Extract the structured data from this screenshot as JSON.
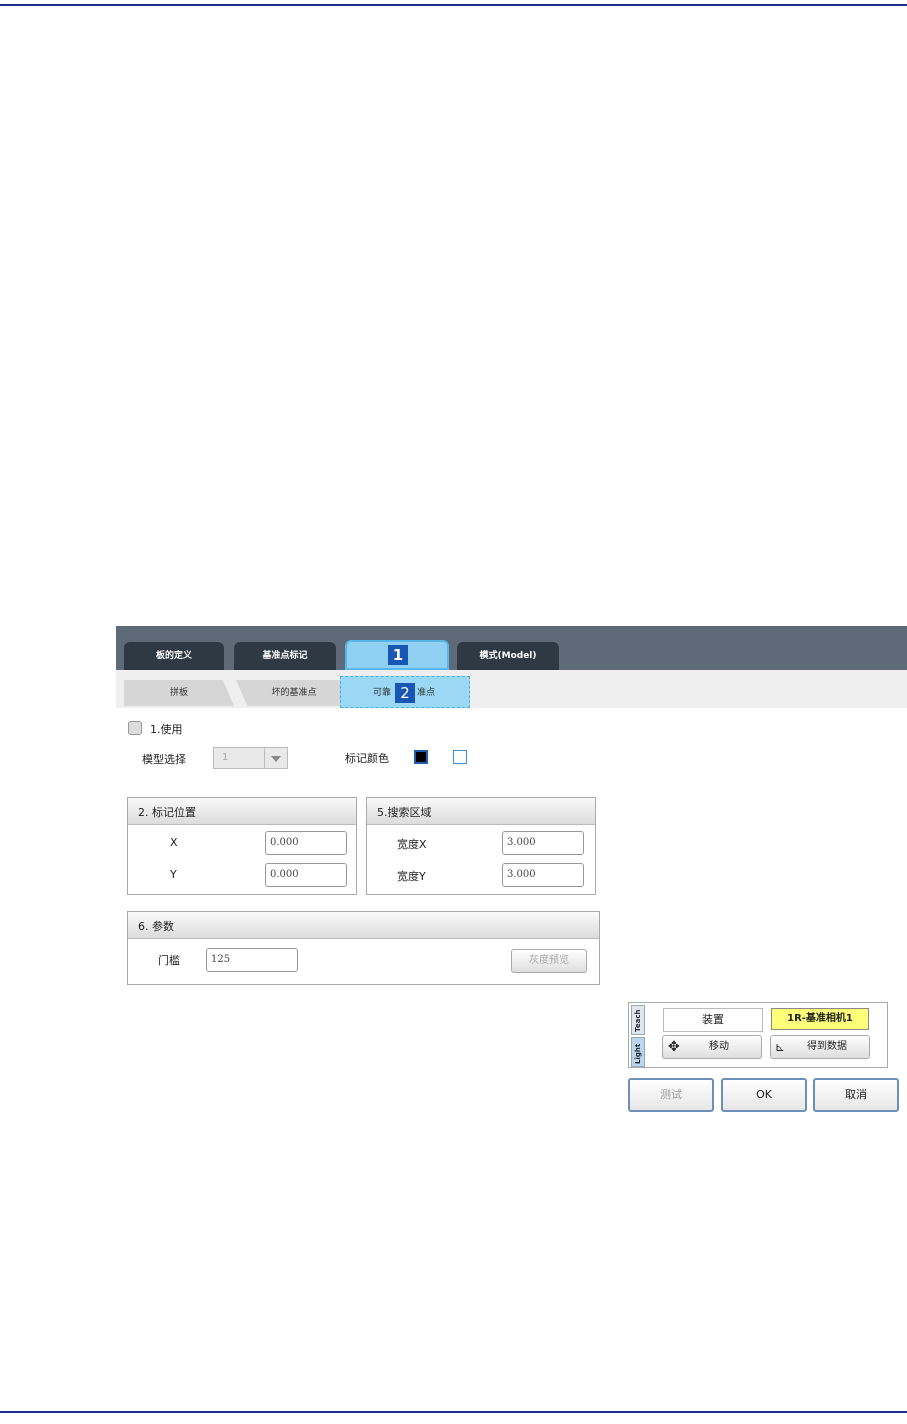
{
  "tabs": [
    "板的定义",
    "基准点标记",
    "",
    "模式(Model)"
  ],
  "callouts": [
    "1",
    "2"
  ],
  "subtabs": [
    "拼板",
    "坏的基准点",
    "可靠",
    "准点"
  ],
  "use_checkbox_label": "1.使用",
  "model_select": {
    "label": "模型选择",
    "value": "1"
  },
  "mark_color": {
    "label": "标记颜色",
    "colors": [
      "#000000",
      "#ffffff"
    ]
  },
  "mark_position": {
    "title": "2. 标记位置",
    "x_label": "X",
    "x_value": "0.000",
    "y_label": "Y",
    "y_value": "0.000"
  },
  "search_area": {
    "title": "5.搜索区域",
    "wx_label": "宽度X",
    "wx_value": "3.000",
    "wy_label": "宽度Y",
    "wy_value": "3.000"
  },
  "params": {
    "title": "6. 参数",
    "threshold_label": "门槛",
    "threshold_value": "125",
    "preview_button": "灰度预览"
  },
  "teach_panel": {
    "tab_teach": "Teach",
    "tab_light": "Light",
    "device_label": "装置",
    "camera_value": "1R-基准相机1",
    "move_button": "移动",
    "get_data_button": "得到数据"
  },
  "buttons": {
    "test": "测试",
    "ok": "OK",
    "cancel": "取消"
  }
}
